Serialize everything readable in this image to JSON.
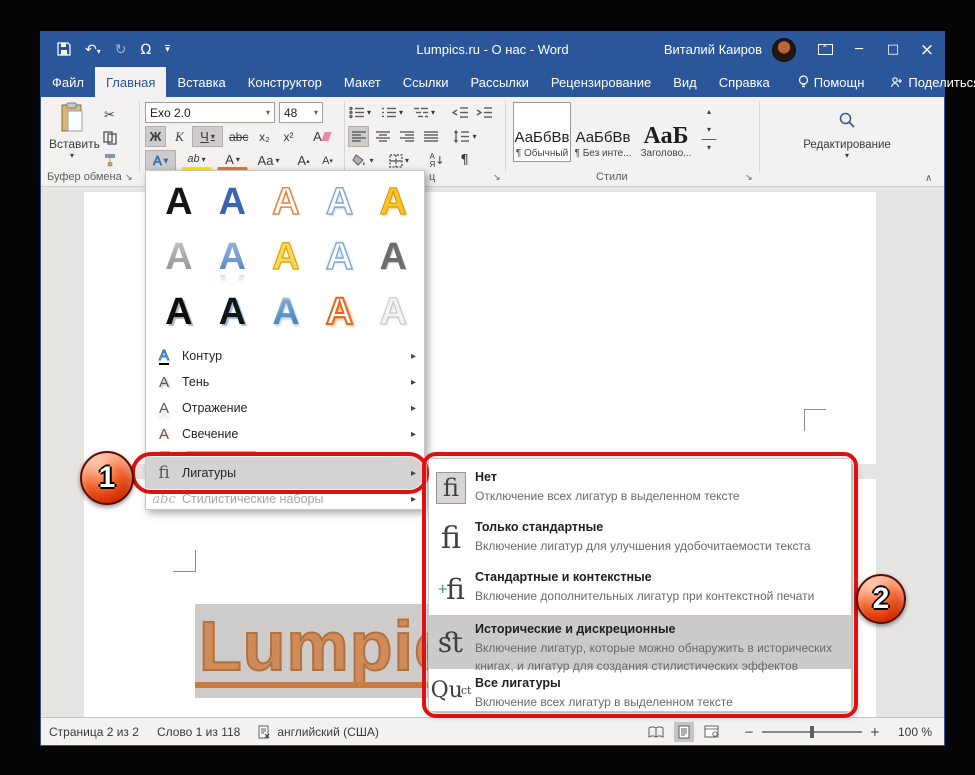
{
  "titlebar": {
    "title": "Lumpics.ru - О нас - Word",
    "user": "Виталий Каиров",
    "qat_symbol": "Ω"
  },
  "tabs": {
    "file": "Файл",
    "home": "Главная",
    "insert": "Вставка",
    "design": "Конструктор",
    "layout": "Макет",
    "references": "Ссылки",
    "mailings": "Рассылки",
    "review": "Рецензирование",
    "view": "Вид",
    "help": "Справка",
    "assist": "Помощн",
    "share": "Поделиться"
  },
  "ribbon": {
    "clipboard": {
      "paste": "Вставить",
      "group": "Буфер обмена"
    },
    "font": {
      "name": "Exo 2.0",
      "size": "48",
      "bold": "Ж",
      "italic": "К",
      "underline": "Ч",
      "strike": "abc",
      "subscript": "x₂",
      "superscript": "x²",
      "effects": "А",
      "highlight": "ab",
      "color": "А",
      "case": "Aa",
      "grow": "А",
      "shrink": "А"
    },
    "paragraph": {
      "label_partial": "ц",
      "sort_a": "А",
      "sort_z": "Я",
      "pilcrow": "¶"
    },
    "styles": {
      "group": "Стили",
      "s1_sample": "АаБбВв",
      "s1_name": "¶ Обычный",
      "s2_sample": "АаБбВв",
      "s2_name": "¶ Без инте...",
      "s3_sample": "АаБ",
      "s3_name": "Заголово..."
    },
    "editing": {
      "group": "Редактирование"
    }
  },
  "effects_menu": {
    "letter": "A",
    "outline": "Контур",
    "shadow": "Тень",
    "reflection": "Отражение",
    "glow": "Свечение",
    "ligatures": "Лигатуры",
    "stylistic": "Стилистические наборы",
    "icon_fi": "ﬁ",
    "icon_abc": "abc"
  },
  "submenu": {
    "items": [
      {
        "icon": "ﬁ",
        "title": "Нет",
        "desc": "Отключение всех лигатур в выделенном тексте"
      },
      {
        "icon": "ﬁ",
        "title": "Только стандартные",
        "desc": "Включение лигатур для улучшения удобочитаемости текста"
      },
      {
        "icon": "ﬁ",
        "plus": "+",
        "title": "Стандартные и контекстные",
        "desc": "Включение дополнительных лигатур при контекстной печати"
      },
      {
        "icon": "ﬆ",
        "title": "Исторические и дискреционные",
        "desc": "Включение лигатур, которые можно обнаружить в исторических книгах, и лигатур для создания стилистических эффектов"
      },
      {
        "icon": "Qu",
        "sup": "ct",
        "title": "Все лигатуры",
        "desc": "Включение всех лигатур в выделенном тексте"
      }
    ]
  },
  "callouts": {
    "step1": "1",
    "step2": "2"
  },
  "document": {
    "selected_text": "Lumpics"
  },
  "statusbar": {
    "page": "Страница 2 из 2",
    "words": "Слово 1 из 118",
    "language": "английский (США)",
    "zoom_level": "100 %"
  }
}
